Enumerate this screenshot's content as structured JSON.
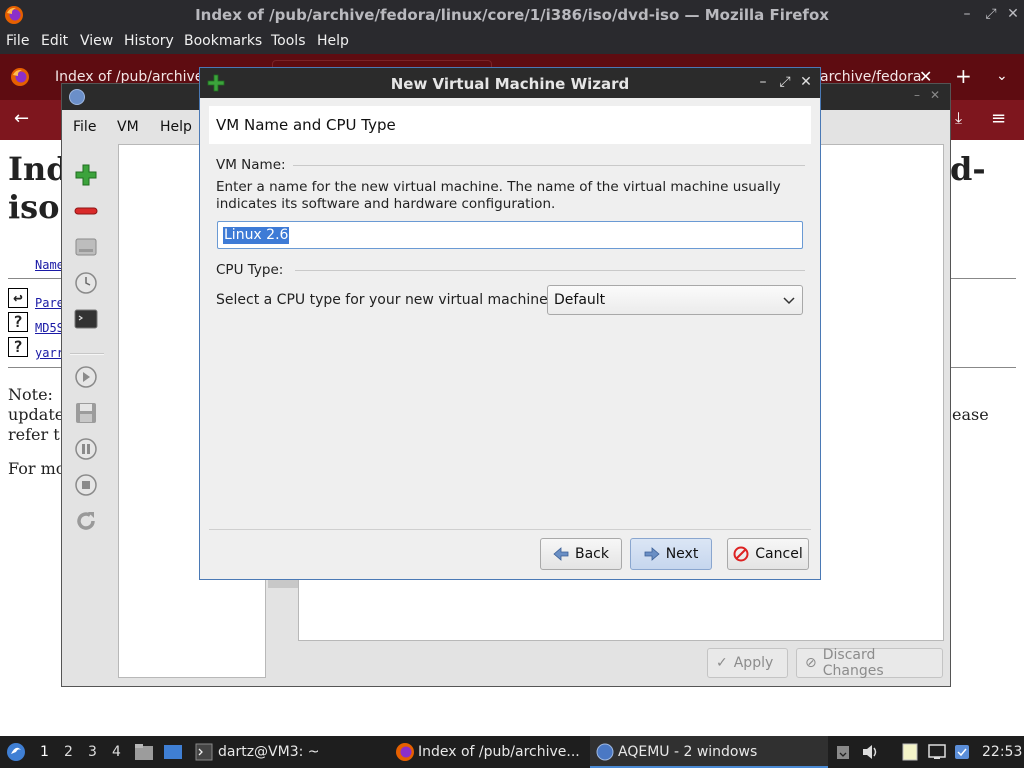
{
  "firefox": {
    "window_title": "Index of /pub/archive/fedora/linux/core/1/i386/iso/dvd-iso — Mozilla Firefox",
    "menu": [
      "File",
      "Edit",
      "View",
      "History",
      "Bookmarks",
      "Tools",
      "Help"
    ],
    "tab_title": "Index of /pub/archive/",
    "tab_right_title": "archive/fedora"
  },
  "page": {
    "heading_left_1": "Ind",
    "heading_left_2": "iso",
    "heading_right": "d-",
    "col_name": "Name",
    "rows": [
      "Pare",
      "MD5S",
      "yarr"
    ],
    "note_line1": "Note: ",
    "note_line2": "update",
    "note_line3": "refer t",
    "note_right": "ease",
    "more_line": "For mo"
  },
  "aqemu": {
    "menu": [
      "File",
      "VM",
      "Help"
    ],
    "apply_label": "Apply",
    "discard_label": "Discard Changes"
  },
  "wizard": {
    "title": "New Virtual Machine Wizard",
    "header": "VM Name and CPU Type",
    "vm_name_section": "VM Name:",
    "vm_name_desc": "Enter a name for the new virtual machine. The name of the virtual machine usually indicates its software and hardware configuration.",
    "vm_name_value": "Linux 2.6",
    "cpu_section": "CPU Type:",
    "cpu_label": "Select a CPU type for your new virtual machine:",
    "cpu_value": "Default",
    "back_label": "Back",
    "next_label": "Next",
    "cancel_label": "Cancel"
  },
  "taskbar": {
    "workspaces": [
      "1",
      "2",
      "3",
      "4"
    ],
    "terminal_label": "dartz@VM3: ~",
    "firefox_label": "Index of /pub/archive...",
    "aqemu_label": "AQEMU - 2 windows",
    "clock": "22:53"
  }
}
